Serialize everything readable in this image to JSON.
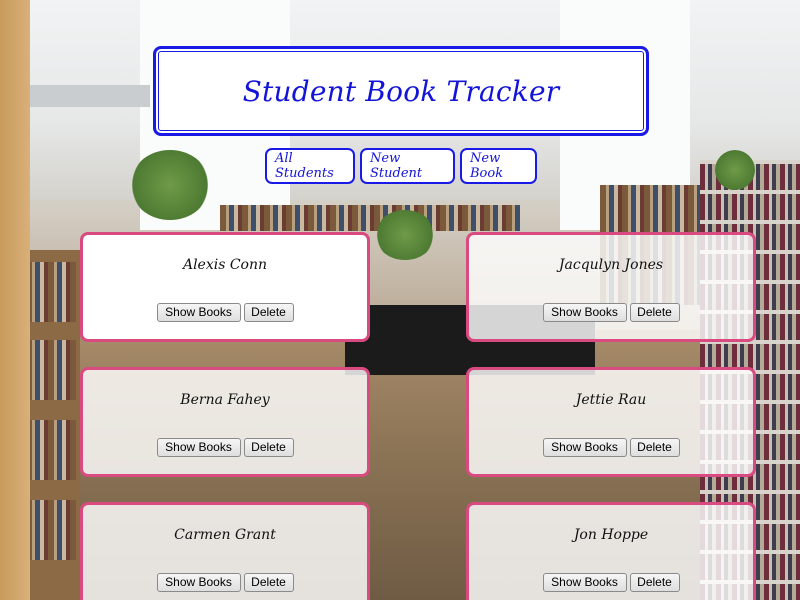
{
  "app": {
    "title": "Student Book Tracker"
  },
  "nav": {
    "all_students": "All Students",
    "new_student": "New Student",
    "new_book": "New Book"
  },
  "students": [
    {
      "name": "Alexis Conn"
    },
    {
      "name": "Jacqulyn Jones"
    },
    {
      "name": "Berna Fahey"
    },
    {
      "name": "Jettie Rau"
    },
    {
      "name": "Carmen Grant"
    },
    {
      "name": "Jon Hoppe"
    }
  ],
  "card_actions": {
    "show_books": "Show Books",
    "delete": "Delete"
  },
  "colors": {
    "accent_blue": "#1a1ae6",
    "card_border_pink": "#d94a80"
  }
}
